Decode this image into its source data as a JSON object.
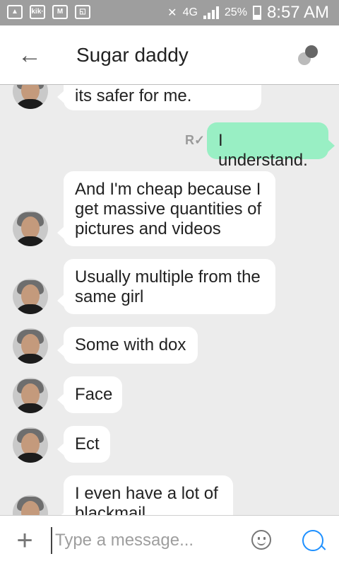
{
  "status_bar": {
    "icons": [
      "image-icon",
      "kik-icon",
      "gmail-icon",
      "screenshot-icon"
    ],
    "kik_text": "kik·",
    "network": "4G",
    "battery": "25%",
    "time": "8:57 AM"
  },
  "header": {
    "title": "Sugar daddy",
    "back_icon": "arrow-left-icon",
    "menu_icon": "overflow-dots-icon"
  },
  "messages": [
    {
      "sender": "them",
      "text": "its safer for me."
    },
    {
      "sender": "me",
      "text": "I understand.",
      "receipt": "R✓"
    },
    {
      "sender": "them",
      "text": "And I'm cheap because I get massive quantities of pictures and videos"
    },
    {
      "sender": "them",
      "text": "Usually multiple from the same girl"
    },
    {
      "sender": "them",
      "text": "Some with dox"
    },
    {
      "sender": "them",
      "text": "Face"
    },
    {
      "sender": "them",
      "text": "Ect"
    },
    {
      "sender": "them",
      "text": "I even have a lot of blackmail"
    }
  ],
  "input": {
    "placeholder": "Type a message...",
    "value": ""
  },
  "colors": {
    "status_bar": "#9e9e9e",
    "outgoing_bubble": "#99efc4",
    "incoming_bubble": "#ffffff",
    "background": "#ececec",
    "send_icon": "#1e90ff"
  }
}
